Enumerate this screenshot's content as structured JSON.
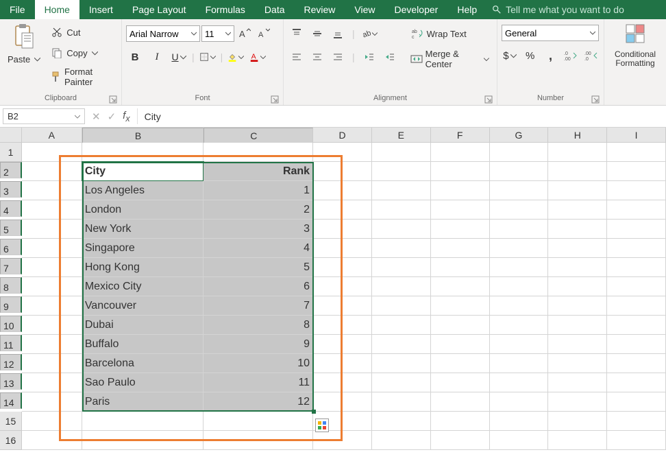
{
  "tabs": [
    "File",
    "Home",
    "Insert",
    "Page Layout",
    "Formulas",
    "Data",
    "Review",
    "View",
    "Developer",
    "Help"
  ],
  "active_tab": "Home",
  "tellme": "Tell me what you want to do",
  "clipboard": {
    "paste": "Paste",
    "cut": "Cut",
    "copy": "Copy",
    "painter": "Format Painter",
    "label": "Clipboard"
  },
  "font": {
    "name": "Arial Narrow",
    "size": "11",
    "label": "Font"
  },
  "alignment": {
    "wrap": "Wrap Text",
    "merge": "Merge & Center",
    "label": "Alignment"
  },
  "number": {
    "format": "General",
    "label": "Number"
  },
  "styles": {
    "cond": "Conditional Formatting"
  },
  "namebox": "B2",
  "formula": "City",
  "cols": [
    "A",
    "B",
    "C",
    "D",
    "E",
    "F",
    "G",
    "H",
    "I"
  ],
  "rowcount": 16,
  "table": {
    "headers": {
      "city": "City",
      "rank": "Rank"
    },
    "rows": [
      {
        "city": "Los Angeles",
        "rank": "1"
      },
      {
        "city": "London",
        "rank": "2"
      },
      {
        "city": "New York",
        "rank": "3"
      },
      {
        "city": "Singapore",
        "rank": "4"
      },
      {
        "city": "Hong Kong",
        "rank": "5"
      },
      {
        "city": "Mexico City",
        "rank": "6"
      },
      {
        "city": "Vancouver",
        "rank": "7"
      },
      {
        "city": "Dubai",
        "rank": "8"
      },
      {
        "city": "Buffalo",
        "rank": "9"
      },
      {
        "city": "Barcelona",
        "rank": "10"
      },
      {
        "city": "Sao Paulo",
        "rank": "11"
      },
      {
        "city": "Paris",
        "rank": "12"
      }
    ]
  }
}
